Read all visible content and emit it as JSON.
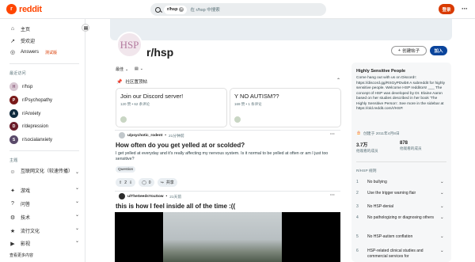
{
  "header": {
    "logo_letter": "r",
    "logo_text": "reddit",
    "search_chip": "r/hsp",
    "search_placeholder": "在 r/hsp 中搜索",
    "login_label": "登录",
    "more_label": "···"
  },
  "sidebar": {
    "nav": [
      {
        "label": "主页",
        "icon": "home-icon"
      },
      {
        "label": "受欢迎",
        "icon": "popular-icon"
      },
      {
        "label": "Answers",
        "tag": "测试版",
        "icon": "answers-icon"
      }
    ],
    "recent_title": "最近访问",
    "recent": [
      {
        "label": "r/hsp",
        "color": "#d8c7d2"
      },
      {
        "label": "r/Psychopathy",
        "color": "#7a1a1a"
      },
      {
        "label": "r/Anxiety",
        "color": "#0f2a3d"
      },
      {
        "label": "r/depression",
        "color": "#6b1d2a"
      },
      {
        "label": "r/socialanxiety",
        "color": "#5a4a6a"
      }
    ],
    "topics_title": "主题",
    "topics": [
      {
        "label": "互联网文化（较速传播）",
        "icon": "internet-culture-icon"
      },
      {
        "label": "游戏",
        "icon": "gaming-icon"
      },
      {
        "label": "问答",
        "icon": "qa-icon"
      },
      {
        "label": "技术",
        "icon": "tech-icon"
      },
      {
        "label": "流行文化",
        "icon": "pop-culture-icon"
      },
      {
        "label": "影视",
        "icon": "movies-tv-icon"
      }
    ],
    "more_topics": "查看更多内容"
  },
  "subreddit": {
    "avatar_text": "HSP",
    "name": "r/hsp",
    "create_post": "创建帖子",
    "join": "加入",
    "sort": "最佳",
    "pinned_title": "社区置顶帖",
    "pinned": [
      {
        "title": "Join our Discord server!",
        "meta": "120 赞 • 62 条评论"
      },
      {
        "title": "Y NO AUTISM??",
        "meta": "169 赞 • 1 条评论"
      }
    ]
  },
  "posts": [
    {
      "author": "u/psychotic_rodent",
      "time": "21分钟前",
      "title": "How often do you get yelled at or scolded?",
      "body": "I get yelled at everyday and it's really affecting my nervous system. Is it normal to be yelled at often or am I just too sensitive?",
      "flair": "Question",
      "votes": "2",
      "comments": "0",
      "share": "共享"
    },
    {
      "author": "u/TheSeedsYouSow",
      "time": "21天前",
      "title": "this is how I feel inside all of the time :(("
    }
  ],
  "about": {
    "title": "Highly Sensitive People",
    "description": "Come hang out with us on Discord!: https://discord.gg/RSGyPDwb8 A subreddit for highly sensitive people. Welcome HSP redditors! ___ The concept of HSP was developed by Dr. Elaine Aaron based on her studies described in her book 'The Highly Sensitive Person'. See more in the sidebar at https://old.reddit.com/r/HSP.",
    "created": "创建于 2011年4月8日",
    "members": {
      "value": "3.7万",
      "label": "他观看的成员"
    },
    "online": {
      "value": "878",
      "label": "他观看的成员"
    },
    "rules_title": "R/HSP 规则",
    "rules": [
      {
        "n": "1",
        "text": "No bullying"
      },
      {
        "n": "2",
        "text": "Use the trigger warning flair"
      },
      {
        "n": "3",
        "text": "No HSP-denial"
      },
      {
        "n": "4",
        "text": "No pathologizing or diagnosing others"
      },
      {
        "n": "5",
        "text": "No HSP-autism conflation"
      },
      {
        "n": "6",
        "text": "HSP-related clinical studies and commercial services for"
      }
    ]
  },
  "colors": {
    "brand": "#ff4500",
    "login": "#d93a00",
    "join": "#0a449b"
  }
}
